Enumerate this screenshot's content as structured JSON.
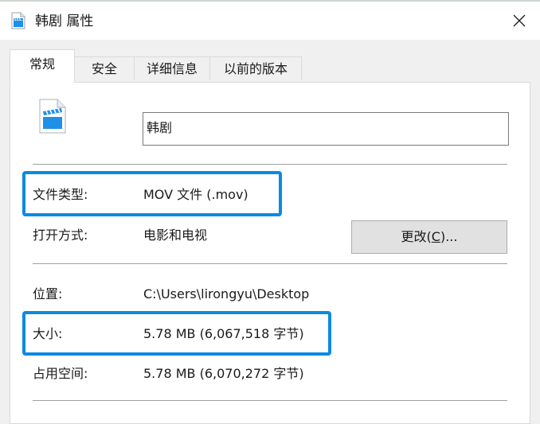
{
  "window": {
    "title": "韩剧 属性"
  },
  "tabs": [
    {
      "label": "常规",
      "active": true
    },
    {
      "label": "安全",
      "active": false
    },
    {
      "label": "详细信息",
      "active": false
    },
    {
      "label": "以前的版本",
      "active": false
    }
  ],
  "general": {
    "file_name": "韩剧",
    "file_type_label": "文件类型:",
    "file_type_value": "MOV 文件 (.mov)",
    "open_with_label": "打开方式:",
    "open_with_value": "电影和电视",
    "change_button": {
      "prefix": "更改(",
      "accel": "C",
      "suffix": ")..."
    },
    "location_label": "位置:",
    "location_value": "C:\\Users\\lirongyu\\Desktop",
    "size_label": "大小:",
    "size_value": "5.78 MB (6,067,518 字节)",
    "size_on_disk_label": "占用空间:",
    "size_on_disk_value": "5.78 MB (6,070,272 字节)"
  },
  "icons": {
    "title": "video-file-icon",
    "file": "video-file-icon",
    "close": "close-icon"
  },
  "colors": {
    "highlight": "#0a8be0",
    "icon_blue": "#1e90e8"
  }
}
